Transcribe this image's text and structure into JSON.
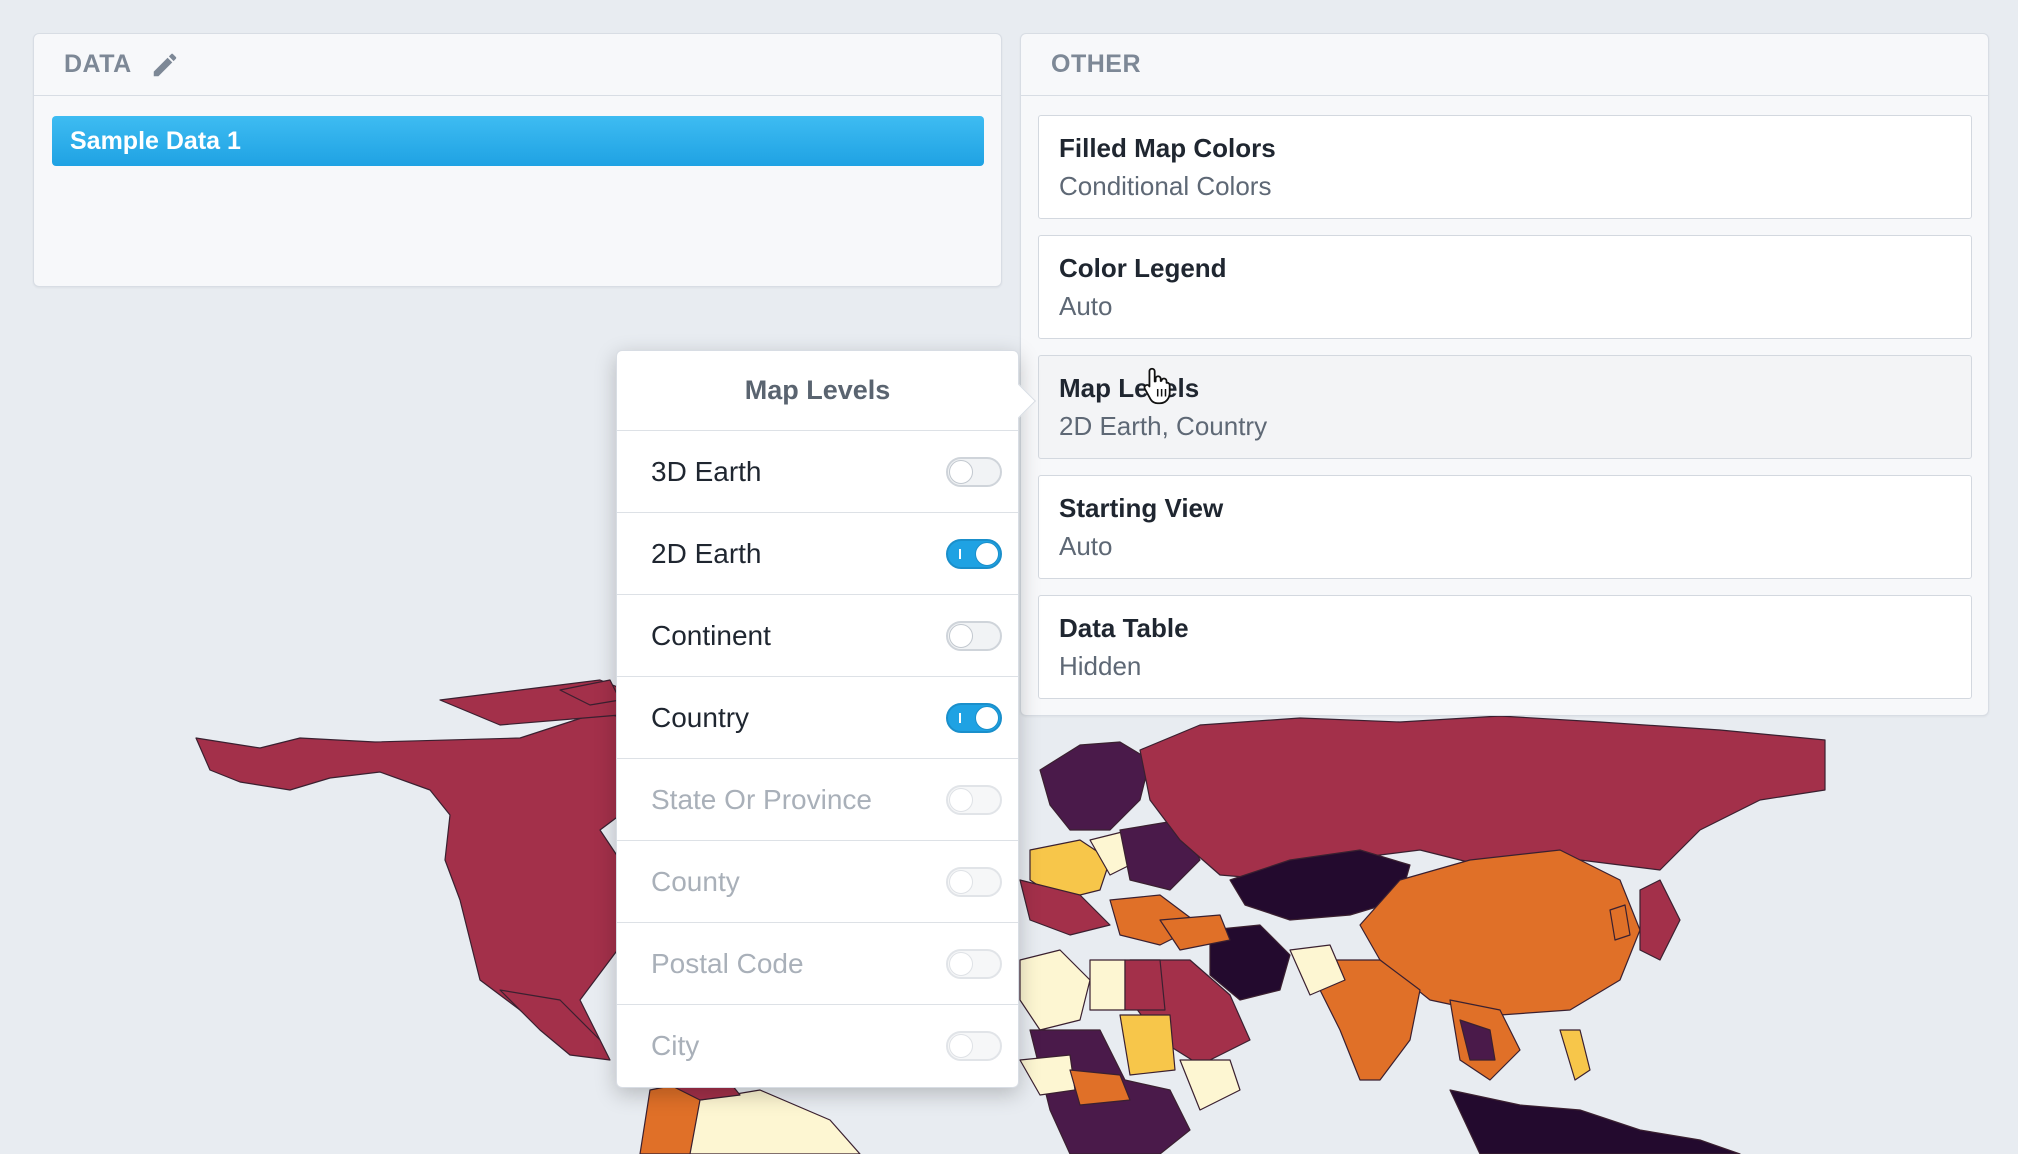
{
  "data_panel": {
    "header": "DATA",
    "datasets": [
      {
        "label": "Sample Data 1",
        "selected": true
      }
    ]
  },
  "other_panel": {
    "header": "OTHER",
    "options": [
      {
        "title": "Filled Map Colors",
        "value": "Conditional Colors"
      },
      {
        "title": "Color Legend",
        "value": "Auto"
      },
      {
        "title": "Map Levels",
        "value": "2D Earth, Country"
      },
      {
        "title": "Starting View",
        "value": "Auto"
      },
      {
        "title": "Data Table",
        "value": "Hidden"
      }
    ]
  },
  "map_levels_popover": {
    "title": "Map Levels",
    "levels": [
      {
        "label": "3D Earth",
        "enabled": false,
        "disabled": false
      },
      {
        "label": "2D Earth",
        "enabled": true,
        "disabled": false
      },
      {
        "label": "Continent",
        "enabled": false,
        "disabled": false
      },
      {
        "label": "Country",
        "enabled": true,
        "disabled": false
      },
      {
        "label": "State Or Province",
        "enabled": false,
        "disabled": true
      },
      {
        "label": "County",
        "enabled": false,
        "disabled": true
      },
      {
        "label": "Postal Code",
        "enabled": false,
        "disabled": true
      },
      {
        "label": "City",
        "enabled": false,
        "disabled": true
      }
    ]
  },
  "colors": {
    "accent": "#1fa2e3",
    "map_crimson": "#a3304a",
    "map_orange": "#e07028",
    "map_purple": "#4a1a4a",
    "map_dark": "#230a2e",
    "map_yellow": "#f7c64a",
    "map_cream": "#fdf6d2",
    "background": "#e8ecf1"
  },
  "icons": {
    "edit": "pencil-icon",
    "cursor": "hand-pointer-icon"
  }
}
